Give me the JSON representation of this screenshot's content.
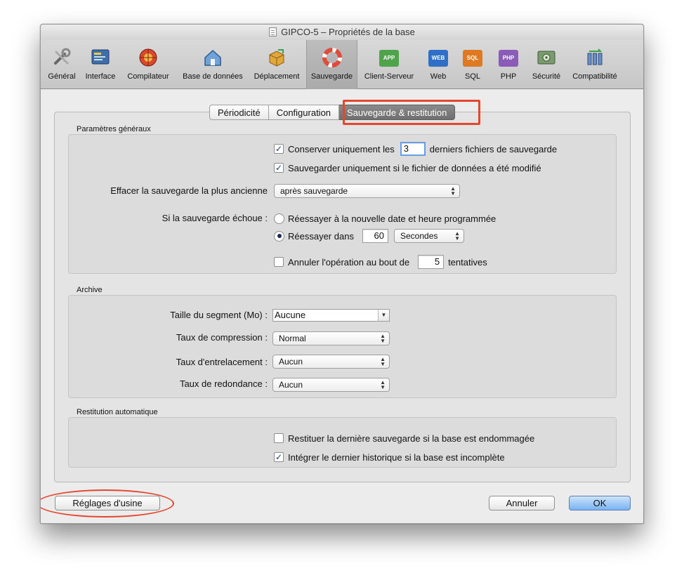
{
  "window": {
    "title": "GIPCO-5 – Propriétés de la base"
  },
  "toolbar": {
    "items": [
      {
        "label": "Général",
        "icon": "tools-icon"
      },
      {
        "label": "Interface",
        "icon": "interface-icon"
      },
      {
        "label": "Compilateur",
        "icon": "compiler-icon"
      },
      {
        "label": "Base de données",
        "icon": "house-icon"
      },
      {
        "label": "Déplacement",
        "icon": "box-icon"
      },
      {
        "label": "Sauvegarde",
        "icon": "lifebuoy-icon",
        "active": true
      },
      {
        "label": "Client-Serveur",
        "icon": "app-icon",
        "badge": "APP"
      },
      {
        "label": "Web",
        "icon": "web-icon",
        "badge": "WEB"
      },
      {
        "label": "SQL",
        "icon": "sql-icon",
        "badge": "SQL"
      },
      {
        "label": "PHP",
        "icon": "php-icon",
        "badge": "PHP"
      },
      {
        "label": "Sécurité",
        "icon": "security-icon"
      },
      {
        "label": "Compatibilité",
        "icon": "compatibility-icon"
      }
    ]
  },
  "tabs": [
    {
      "label": "Périodicité"
    },
    {
      "label": "Configuration"
    },
    {
      "label": "Sauvegarde & restitution",
      "active": true
    }
  ],
  "general": {
    "label": "Paramètres généraux",
    "keep_only_prefix": "Conserver uniquement les",
    "keep_only_value": "3",
    "keep_only_suffix": "derniers fichiers de sauvegarde",
    "keep_only_checked": true,
    "only_if_modified": "Sauvegarder uniquement si le fichier de données a été modifié",
    "only_if_modified_checked": true,
    "erase_oldest_label": "Effacer la sauvegarde la plus ancienne",
    "erase_oldest_value": "après sauvegarde",
    "on_failure_label": "Si la sauvegarde échoue :",
    "retry_scheduled": "Réessayer à la nouvelle date et heure programmée",
    "retry_in": "Réessayer dans",
    "retry_in_value": "60",
    "retry_unit": "Secondes",
    "cancel_after_prefix": "Annuler l'opération au bout de",
    "cancel_after_value": "5",
    "cancel_after_suffix": "tentatives"
  },
  "archive": {
    "label": "Archive",
    "segment_label": "Taille du segment (Mo) :",
    "segment_value": "Aucune",
    "compression_label": "Taux de compression :",
    "compression_value": "Normal",
    "interlacing_label": "Taux d'entrelacement :",
    "interlacing_value": "Aucun",
    "redundancy_label": "Taux de redondance :",
    "redundancy_value": "Aucun"
  },
  "restore": {
    "label": "Restitution automatique",
    "restore_last": "Restituer la dernière sauvegarde si la base est endommagée",
    "restore_last_checked": false,
    "integrate_log": "Intégrer le dernier historique si la base est incomplète",
    "integrate_log_checked": true
  },
  "buttons": {
    "factory": "Réglages d'usine",
    "cancel": "Annuler",
    "ok": "OK"
  },
  "colors": {
    "highlight": "#e5462e",
    "default_button": "#79b3f2"
  }
}
